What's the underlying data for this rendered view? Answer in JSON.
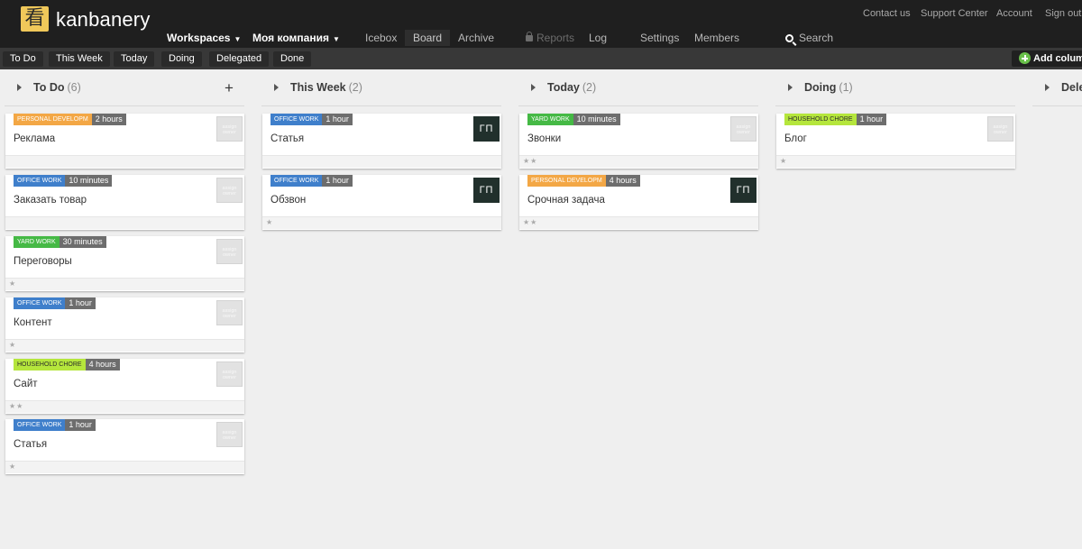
{
  "brand": {
    "logo_glyph": "看",
    "name": "kanbanery"
  },
  "util_links": [
    "Contact us",
    "Support Center",
    "Account",
    "Sign out"
  ],
  "nav": {
    "workspaces": "Workspaces",
    "company": "Моя компания",
    "icebox": "Icebox",
    "board": "Board",
    "archive": "Archive",
    "reports": "Reports",
    "log": "Log",
    "settings": "Settings",
    "members": "Members",
    "search": "Search"
  },
  "filters": [
    "To Do",
    "This Week",
    "Today",
    "Doing",
    "Delegated",
    "Done"
  ],
  "add_column": "Add column",
  "colors": {
    "office_work": "#3f7fcb",
    "personal_develop": "#f3a745",
    "yard_work": "#45b945",
    "household_chore": "#b5e63c",
    "avatar_bg": "#21302c"
  },
  "assign_owner": "assign owner",
  "columns": [
    {
      "name": "To Do",
      "count": "(6)",
      "add": "+",
      "cards": [
        {
          "tag": "PERSONAL DEVELOPM",
          "tag_class": "c-personal",
          "duration": "2 hours",
          "title": "Реклама",
          "owner": "",
          "stars": ""
        },
        {
          "tag": "OFFICE WORK",
          "tag_class": "c-office",
          "duration": "10 minutes",
          "title": "Заказать товар",
          "owner": "",
          "stars": ""
        },
        {
          "tag": "YARD WORK",
          "tag_class": "c-yard",
          "duration": "30 minutes",
          "title": "Переговоры",
          "owner": "",
          "stars": "★"
        },
        {
          "tag": "OFFICE WORK",
          "tag_class": "c-office",
          "duration": "1 hour",
          "title": "Контент",
          "owner": "",
          "stars": "★"
        },
        {
          "tag": "HOUSEHOLD CHORE",
          "tag_class": "c-household",
          "duration": "4 hours",
          "title": "Сайт",
          "owner": "",
          "stars": "★★"
        },
        {
          "tag": "OFFICE WORK",
          "tag_class": "c-office",
          "duration": "1 hour",
          "title": "Статья",
          "owner": "",
          "stars": "★"
        }
      ]
    },
    {
      "name": "This Week",
      "count": "(2)",
      "cards": [
        {
          "tag": "OFFICE WORK",
          "tag_class": "c-office",
          "duration": "1 hour",
          "title": "Статья",
          "owner": "ГП",
          "stars": ""
        },
        {
          "tag": "OFFICE WORK",
          "tag_class": "c-office",
          "duration": "1 hour",
          "title": "Обзвон",
          "owner": "ГП",
          "stars": "★"
        }
      ]
    },
    {
      "name": "Today",
      "count": "(2)",
      "cards": [
        {
          "tag": "YARD WORK",
          "tag_class": "c-yard",
          "duration": "10 minutes",
          "title": "Звонки",
          "owner": "",
          "stars": "★★"
        },
        {
          "tag": "PERSONAL DEVELOPM",
          "tag_class": "c-personal",
          "duration": "4 hours",
          "title": "Срочная задача",
          "owner": "ГП",
          "stars": "★★"
        }
      ]
    },
    {
      "name": "Doing",
      "count": "(1)",
      "cards": [
        {
          "tag": "HOUSEHOLD CHORE",
          "tag_class": "c-household",
          "duration": "1 hour",
          "title": "Блог",
          "owner": "",
          "stars": "★"
        }
      ]
    },
    {
      "name": "Dele",
      "count": "",
      "cards": []
    }
  ]
}
